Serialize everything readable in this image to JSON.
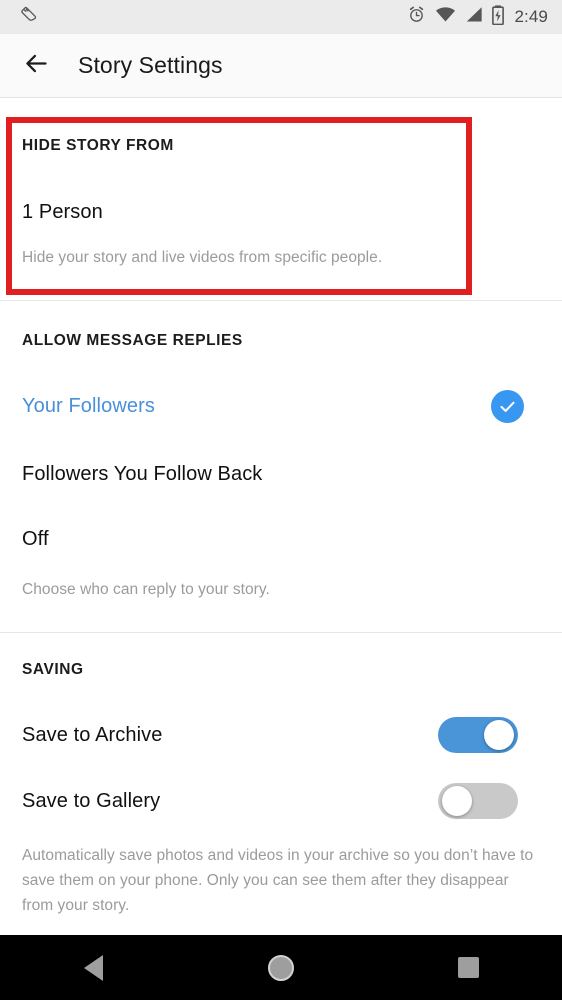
{
  "status_bar": {
    "left_icons": [
      {
        "name": "shoe-fitness-icon",
        "label": "Fitness activity"
      }
    ],
    "right_icons": [
      {
        "name": "alarm-clock-icon",
        "label": "Alarm set"
      },
      {
        "name": "wifi-icon",
        "label": "Wi-Fi connected"
      },
      {
        "name": "cellular-signal-icon",
        "label": "Cellular signal"
      },
      {
        "name": "battery-charging-icon",
        "label": "Battery charging"
      }
    ],
    "time": "2:49"
  },
  "app_bar": {
    "back_icon": "arrow-left-icon",
    "title": "Story Settings"
  },
  "sections": [
    {
      "id": "hide-story-from",
      "header": "HIDE STORY FROM",
      "value_label": "1 Person",
      "helper": "Hide your story and live videos from specific people.",
      "highlighted": true
    },
    {
      "id": "allow-message-replies",
      "header": "ALLOW MESSAGE REPLIES",
      "options": [
        {
          "label": "Your Followers",
          "selected": true
        },
        {
          "label": "Followers You Follow Back",
          "selected": false
        },
        {
          "label": "Off",
          "selected": false
        }
      ],
      "helper": "Choose who can reply to your story."
    },
    {
      "id": "saving",
      "header": "SAVING",
      "toggles": [
        {
          "label": "Save to Archive",
          "state": "on"
        },
        {
          "label": "Save to Gallery",
          "state": "off"
        }
      ],
      "helper": "Automatically save photos and videos in your archive so you don’t have to save them on your phone. Only you can see them after they disappear from your story."
    }
  ],
  "nav_bar": {
    "back": "back-triangle-icon",
    "home": "home-circle-icon",
    "recents": "recents-square-icon"
  },
  "colors": {
    "accent_blue": "#3897f0",
    "link_blue": "#4a90d9",
    "toggle_on": "#4a94d8",
    "toggle_off": "#c9c9c9",
    "highlight_red": "#e02020",
    "status_bar_bg": "#ebebeb",
    "app_bar_bg": "#fafafa",
    "helper_text": "#9b9b9b"
  }
}
